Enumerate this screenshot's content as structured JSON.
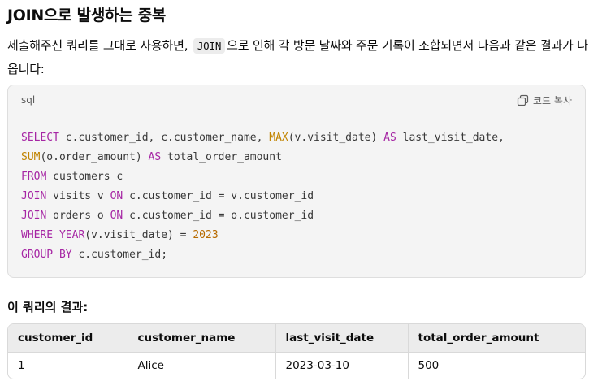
{
  "heading": "JOIN으로 발생하는 중복",
  "paragraph": {
    "before": "제출해주신 쿼리를 그대로 사용하면,",
    "code": "JOIN",
    "after": "으로 인해 각 방문 날짜와 주문 기록이 조합되면서 다음과 같은 결과가 나옵니다:"
  },
  "code_block": {
    "language": "sql",
    "copy_label": "코드 복사",
    "lines": [
      [
        {
          "t": "SELECT",
          "c": "kw"
        },
        {
          "t": " c.customer_id, c.customer_name, "
        },
        {
          "t": "MAX",
          "c": "fn"
        },
        {
          "t": "(v.visit_date) "
        },
        {
          "t": "AS",
          "c": "kw"
        },
        {
          "t": " last_visit_date,"
        }
      ],
      [
        {
          "t": "SUM",
          "c": "fn"
        },
        {
          "t": "(o.order_amount) "
        },
        {
          "t": "AS",
          "c": "kw"
        },
        {
          "t": " total_order_amount"
        }
      ],
      [
        {
          "t": "FROM",
          "c": "kw"
        },
        {
          "t": " customers c"
        }
      ],
      [
        {
          "t": "JOIN",
          "c": "kw"
        },
        {
          "t": " visits v "
        },
        {
          "t": "ON",
          "c": "kw"
        },
        {
          "t": " c.customer_id = v.customer_id"
        }
      ],
      [
        {
          "t": "JOIN",
          "c": "kw"
        },
        {
          "t": " orders o "
        },
        {
          "t": "ON",
          "c": "kw"
        },
        {
          "t": " c.customer_id = o.customer_id"
        }
      ],
      [
        {
          "t": "WHERE",
          "c": "kw"
        },
        {
          "t": " "
        },
        {
          "t": "YEAR",
          "c": "kw"
        },
        {
          "t": "(v.visit_date) = "
        },
        {
          "t": "2023",
          "c": "num"
        }
      ],
      [
        {
          "t": "GROUP BY",
          "c": "kw"
        },
        {
          "t": " c.customer_id;"
        }
      ]
    ]
  },
  "result_title": "이 쿼리의 결과:",
  "table": {
    "headers": [
      "customer_id",
      "customer_name",
      "last_visit_date",
      "total_order_amount"
    ],
    "rows": [
      [
        "1",
        "Alice",
        "2023-03-10",
        "500"
      ]
    ]
  }
}
